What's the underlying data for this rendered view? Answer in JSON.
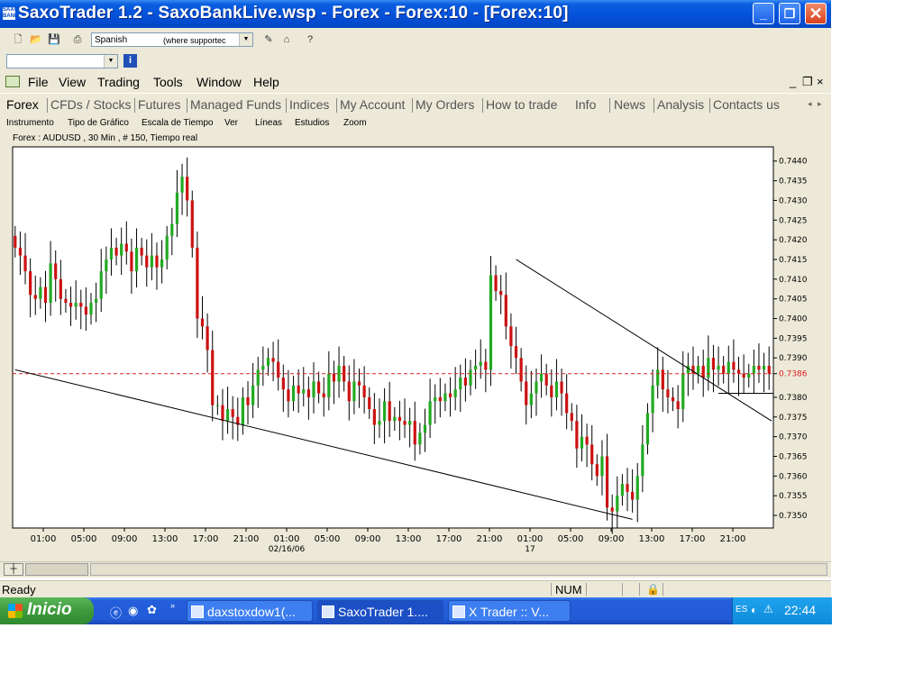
{
  "window": {
    "title": "SaxoTrader 1.2 - SaxoBankLive.wsp - Forex - Forex:10 - [Forex:10]",
    "icon_text": "SAXO BANK",
    "controls": [
      "minimize-icon",
      "maximize-icon",
      "close-icon"
    ]
  },
  "toolbar1": {
    "language": "Spanish",
    "language_note": "(where supportec"
  },
  "toolbar2": {
    "instrument_value": ""
  },
  "menubar": {
    "items": [
      "File",
      "View",
      "Trading",
      "Tools",
      "Window",
      "Help"
    ]
  },
  "tabs": {
    "items": [
      "Forex",
      "CFDs / Stocks",
      "Futures",
      "Managed Funds",
      "Indices",
      "My Account",
      "My Orders",
      "How to trade",
      "Info",
      "News",
      "Analysis",
      "Contacts us"
    ],
    "active": "Forex"
  },
  "chart_menu": {
    "items": [
      "Instrumento",
      "Tipo de Gráfico",
      "Escala de Tiempo",
      "Ver",
      "Líneas",
      "Estudios",
      "Zoom"
    ]
  },
  "chart_info": "Forex : AUDUSD , 30 Min , # 150, Tiempo real",
  "status": {
    "text": "Ready",
    "mode": "NUM"
  },
  "taskbar": {
    "start": "Inicio",
    "tasks": [
      "daxstoxdow1(...",
      "SaxoTrader 1....",
      "X Trader :: V..."
    ],
    "active_task": 1,
    "lang": "ES",
    "clock": "22:44"
  },
  "colors": {
    "up_candle": "#22aa22",
    "down_candle": "#cc1111",
    "current_price_line": "#dd2222",
    "titlebar": "#0450d8",
    "taskbar": "#245edb"
  },
  "chart_data": {
    "type": "candlestick",
    "symbol": "AUDUSD",
    "timeframe": "30 Min",
    "bars": 150,
    "y_ticks": [
      "0.7440",
      "0.7435",
      "0.7430",
      "0.7425",
      "0.7420",
      "0.7415",
      "0.7410",
      "0.7405",
      "0.7400",
      "0.7395",
      "0.7390",
      "0.7386",
      "0.7380",
      "0.7375",
      "0.7370",
      "0.7365",
      "0.7360",
      "0.7355",
      "0.7350"
    ],
    "ylim": [
      0.73468,
      0.74436
    ],
    "current_price": 0.7386,
    "x_ticks": [
      "01:00",
      "05:00",
      "09:00",
      "13:00",
      "17:00",
      "21:00",
      "01:00",
      "05:00",
      "09:00",
      "13:00",
      "17:00",
      "21:00",
      "01:00",
      "05:00",
      "09:00",
      "13:00",
      "17:00",
      "21:00"
    ],
    "x_dates": [
      "02/16/06",
      "17"
    ],
    "closes": [
      0.7418,
      0.7416,
      0.7412,
      0.7406,
      0.7405,
      0.7408,
      0.7404,
      0.7414,
      0.741,
      0.7405,
      0.7404,
      0.7403,
      0.7404,
      0.7403,
      0.7401,
      0.7404,
      0.7405,
      0.7412,
      0.7415,
      0.7418,
      0.7416,
      0.7419,
      0.7417,
      0.7412,
      0.7418,
      0.7416,
      0.7413,
      0.7416,
      0.7413,
      0.7415,
      0.7421,
      0.7424,
      0.7432,
      0.7436,
      0.743,
      0.7418,
      0.74,
      0.7398,
      0.7392,
      0.7378,
      0.7378,
      0.7374,
      0.7377,
      0.7375,
      0.7373,
      0.738,
      0.7378,
      0.7383,
      0.7387,
      0.7388,
      0.739,
      0.7389,
      0.7385,
      0.7382,
      0.7379,
      0.7383,
      0.7381,
      0.7382,
      0.738,
      0.7384,
      0.7381,
      0.738,
      0.7386,
      0.7384,
      0.7388,
      0.7384,
      0.7379,
      0.7384,
      0.7383,
      0.738,
      0.7377,
      0.7373,
      0.7374,
      0.7379,
      0.7374,
      0.7375,
      0.7374,
      0.7373,
      0.7374,
      0.7368,
      0.7371,
      0.7373,
      0.7379,
      0.738,
      0.7379,
      0.7381,
      0.738,
      0.7382,
      0.7385,
      0.7383,
      0.7387,
      0.7388,
      0.7389,
      0.7387,
      0.7411,
      0.7407,
      0.7406,
      0.7398,
      0.7393,
      0.739,
      0.7384,
      0.7378,
      0.7381,
      0.7384,
      0.7386,
      0.7383,
      0.738,
      0.7384,
      0.7381,
      0.7376,
      0.7374,
      0.7367,
      0.737,
      0.7368,
      0.7363,
      0.736,
      0.7365,
      0.7352,
      0.7351,
      0.7355,
      0.7358,
      0.7356,
      0.7354,
      0.736,
      0.7368,
      0.7376,
      0.7383,
      0.7387,
      0.7382,
      0.738,
      0.7379,
      0.7377,
      0.7386,
      0.7388,
      0.7386,
      0.7388,
      0.7385,
      0.739,
      0.7387,
      0.7388,
      0.7386,
      0.7389,
      0.7387,
      0.7386,
      0.7385,
      0.7386,
      0.7388,
      0.7387,
      0.7388,
      0.7386
    ],
    "trendlines": [
      {
        "from": [
          0,
          0.7387
        ],
        "to": [
          122,
          0.7349
        ]
      },
      {
        "from": [
          99,
          0.7415
        ],
        "to": [
          150,
          0.7374
        ]
      }
    ],
    "support_segment": {
      "from": [
        139,
        0.7381
      ],
      "to": [
        150,
        0.7381
      ]
    }
  }
}
